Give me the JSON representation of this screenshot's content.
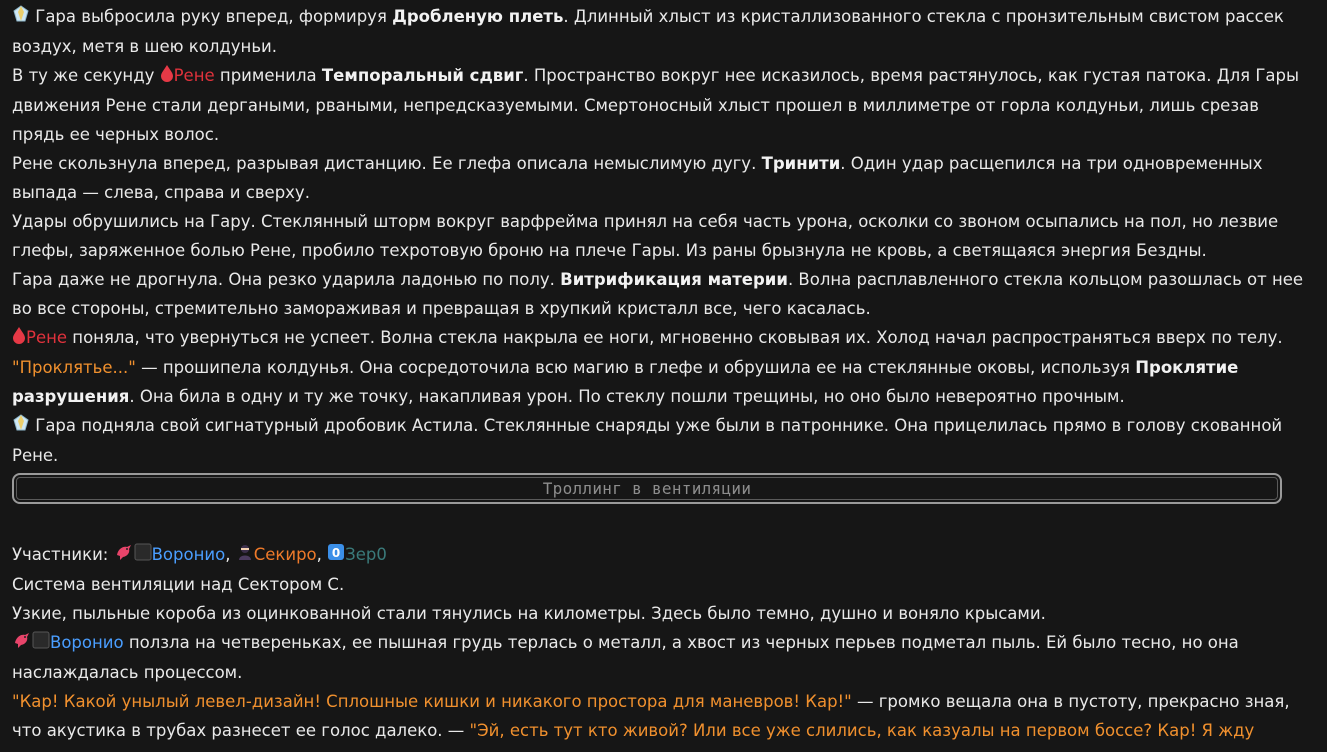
{
  "messages": [
    {
      "a": "Гара",
      "b": " выбросила руку вперед, формируя ",
      "c": "Дробленую плеть",
      "d": ". Длинный хлыст из кристаллизованного стекла с пронзительным свистом рассек воздух, метя в шею колдуньи."
    },
    {
      "a": "В ту же секунду ",
      "b": "Рене",
      "c": " применила ",
      "d": "Темпоральный сдвиг",
      "e": ". Пространство вокруг нее исказилось, время растянулось, как густая патока. Для Гары движения Рене стали дергаными, рваными, непредсказуемыми. Смертоносный хлыст прошел в миллиметре от горла колдуньи, лишь срезав прядь ее черных волос."
    },
    {
      "a": "Рене скользнула вперед, разрывая дистанцию. Ее глефа описала немыслимую дугу. ",
      "b": "Тринити",
      "c": ". Один удар расщепился на три одновременных выпада — слева, справа и сверху."
    },
    {
      "a": "Удары обрушились на Гару. Стеклянный шторм вокруг варфрейма принял на себя часть урона, осколки со звоном осыпались на пол, но лезвие глефы, заряженное болью Рене, пробило техротовую броню на плече Гары. Из раны брызнула не кровь, а светящаяся энергия Бездны."
    },
    {
      "a": "Гара даже не дрогнула. Она резко ударила ладонью по полу. ",
      "b": "Витрификация материи",
      "c": ". Волна расплавленного стекла кольцом разошлась от нее во все стороны, стремительно замораживая и превращая в хрупкий кристалл все, чего касалась."
    },
    {
      "a": "Рене",
      "b": " поняла, что увернуться не успеет. Волна стекла накрыла ее ноги, мгновенно сковывая их. Холод начал распространяться вверх по телу."
    },
    {
      "a": "\"Проклятье...\"",
      "b": " — прошипела колдунья. Она сосредоточила всю магию в глефе и обрушила ее на стеклянные оковы, используя ",
      "c": "Проклятие разрушения",
      "d": ". Она била в одну и ту же точку, накапливая урон. По стеклу пошли трещины, но оно было невероятно прочным."
    },
    {
      "a": "Гара",
      "b": " подняла свой сигнатурный дробовик Астила. Стеклянные снаряды уже были в патроннике. Она прицелилась прямо в голову скованной Рене."
    }
  ],
  "divider_title": "Троллинг в вентиляции",
  "participants": {
    "label": "Участники: ",
    "voronio": "Воронио",
    "sep1": ", ",
    "sekiro": "Секиро",
    "sep2": ", ",
    "zero_badge": "0",
    "zer": "Зер0"
  },
  "scene": [
    {
      "a": "Система вентиляции над Сектором С."
    },
    {
      "a": "Узкие, пыльные короба из оцинкованной стали тянулись на километры. Здесь было темно, душно и воняло крысами."
    },
    {
      "a": "Воронио",
      "b": " ползла на четвереньках, ее пышная грудь терлась о металл, а хвост из черных перьев подметал пыль. Ей было тесно, но она наслаждалась процессом."
    },
    {
      "a": "\"Кар! Какой унылый левел-дизайн! Сплошные кишки и никакого простора для маневров! Кар!\"",
      "b": " — громко вещала она в пустоту, прекрасно зная, что акустика в трубах разнесет ее голос далеко. — ",
      "c": "\"Эй, есть тут кто живой? Или все уже слились, как казуалы на первом боссе? Кар! Я жду"
    }
  ],
  "colors": {
    "background": "#161616",
    "text": "#e9e9e9",
    "rene": "#e0323c",
    "speech": "#f0902e",
    "voronio": "#4a9eff",
    "sekiro": "#ef7a2a",
    "zer": "#3a7a7a"
  },
  "icons": {
    "gara": "crystal-icon",
    "rene": "blood-drop-icon",
    "voronio": "raven-icon",
    "voronio_square": "black-square-icon",
    "sekiro": "ninja-icon",
    "zero": "zero-keycap-icon"
  }
}
